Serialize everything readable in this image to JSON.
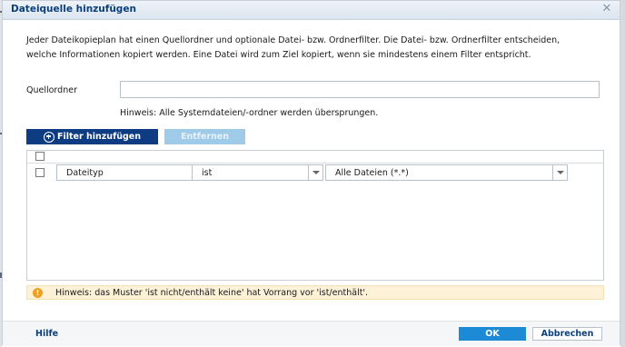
{
  "dialog": {
    "title": "Dateiquelle hinzufügen",
    "close_glyph": "✕",
    "intro": "Jeder Dateikopieplan hat einen Quellordner und optionale Datei- bzw. Ordnerfilter. Die Datei- bzw. Ordnerfilter entscheiden, welche Informationen kopiert werden. Eine Datei wird zum Ziel kopiert, wenn sie mindestens einem Filter entspricht."
  },
  "source": {
    "label": "Quellordner",
    "value": "",
    "hint": "Hinweis: Alle Systemdateien/-ordner werden übersprungen."
  },
  "toolbar": {
    "add_label": "Filter hinzufügen",
    "remove_label": "Entfernen"
  },
  "filters": [
    {
      "type": "Dateityp",
      "operator": "ist",
      "value": "Alle Dateien (*.*)"
    }
  ],
  "notice": {
    "icon": "warning-icon",
    "glyph": "!",
    "text": "Hinweis: das Muster 'ist nicht/enthält keine' hat Vorrang vor 'ist/enthält'."
  },
  "footer": {
    "help_label": "Hilfe",
    "ok_label": "OK",
    "cancel_label": "Abbrechen"
  },
  "colors": {
    "accent": "#0d3c82",
    "ok_button": "#1c8ad4",
    "disabled_button": "#9fcbe8",
    "notice_bg": "#fdf1d8",
    "warning": "#f0a020"
  }
}
